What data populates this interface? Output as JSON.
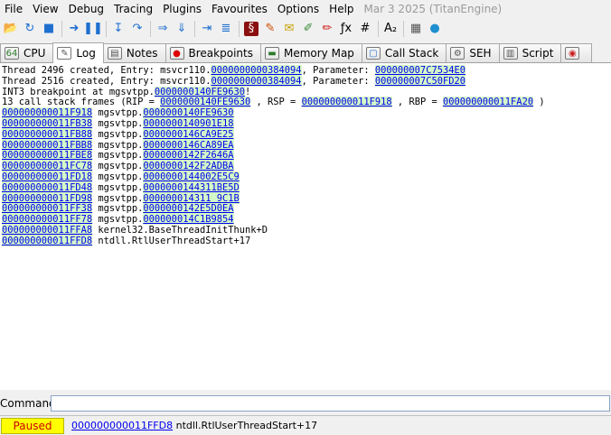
{
  "menu": {
    "items": [
      "File",
      "View",
      "Debug",
      "Tracing",
      "Plugins",
      "Favourites",
      "Options",
      "Help"
    ],
    "build_info": "Mar 3 2025 (TitanEngine)"
  },
  "toolbar": {
    "icons": [
      {
        "name": "open-icon",
        "glyph": "📂",
        "color": "#d8a000"
      },
      {
        "name": "restart-icon",
        "glyph": "↻",
        "color": "#1e6fd0"
      },
      {
        "name": "close-icon",
        "glyph": "■",
        "color": "#1e6fd0"
      },
      {
        "name": "sep1",
        "sep": true
      },
      {
        "name": "run-icon",
        "glyph": "➜",
        "color": "#1e6fd0"
      },
      {
        "name": "pause-icon",
        "glyph": "❚❚",
        "color": "#1e6fd0"
      },
      {
        "name": "sep2",
        "sep": true
      },
      {
        "name": "step-into-icon",
        "glyph": "↧",
        "color": "#1e6fd0"
      },
      {
        "name": "step-over-icon",
        "glyph": "↷",
        "color": "#1e6fd0"
      },
      {
        "name": "sep3",
        "sep": true
      },
      {
        "name": "trace-into-icon",
        "glyph": "⇒",
        "color": "#1e6fd0"
      },
      {
        "name": "trace-over-icon",
        "glyph": "⇓",
        "color": "#1e6fd0"
      },
      {
        "name": "sep4",
        "sep": true
      },
      {
        "name": "run-to-user-code-icon",
        "glyph": "⇥",
        "color": "#1e6fd0"
      },
      {
        "name": "animate-icon",
        "glyph": "≣",
        "color": "#1e6fd0"
      },
      {
        "name": "sep5",
        "sep": true
      },
      {
        "name": "scylla-icon",
        "glyph": "§",
        "color": "#ffffff",
        "bg": "#8b1010"
      },
      {
        "name": "patch-icon",
        "glyph": "✎",
        "color": "#d04a00"
      },
      {
        "name": "comments-icon",
        "glyph": "✉",
        "color": "#c8a000"
      },
      {
        "name": "labels-icon",
        "glyph": "✐",
        "color": "#3a8a3a"
      },
      {
        "name": "bookmarks-icon",
        "glyph": "✏",
        "color": "#d02020"
      },
      {
        "name": "functions-icon",
        "glyph": "ƒx",
        "color": "#000000"
      },
      {
        "name": "hash-icon",
        "glyph": "#",
        "color": "#000000"
      },
      {
        "name": "sep6",
        "sep": true
      },
      {
        "name": "strings-icon",
        "glyph": "A₂",
        "color": "#000000"
      },
      {
        "name": "sep7",
        "sep": true
      },
      {
        "name": "calculator-icon",
        "glyph": "▦",
        "color": "#555555"
      },
      {
        "name": "globe-icon",
        "glyph": "●",
        "color": "#1e8fd0"
      }
    ]
  },
  "tabs": [
    {
      "name": "tab-cpu",
      "label": "CPU",
      "icon": "cpu-icon",
      "glyph": "64",
      "color": "#2a7a2a",
      "active": false
    },
    {
      "name": "tab-log",
      "label": "Log",
      "icon": "log-icon",
      "glyph": "✎",
      "color": "#555",
      "active": true
    },
    {
      "name": "tab-notes",
      "label": "Notes",
      "icon": "notes-icon",
      "glyph": "▤",
      "color": "#555",
      "active": false
    },
    {
      "name": "tab-breakpoints",
      "label": "Breakpoints",
      "icon": "breakpoint-icon",
      "glyph": "●",
      "color": "#dd0000",
      "active": false
    },
    {
      "name": "tab-memory-map",
      "label": "Memory Map",
      "icon": "memory-map-icon",
      "glyph": "▬",
      "color": "#2a7a2a",
      "active": false
    },
    {
      "name": "tab-call-stack",
      "label": "Call Stack",
      "icon": "call-stack-icon",
      "glyph": "▢",
      "color": "#1e6fd0",
      "active": false
    },
    {
      "name": "tab-seh",
      "label": "SEH",
      "icon": "seh-icon",
      "glyph": "⚙",
      "color": "#555",
      "active": false
    },
    {
      "name": "tab-script",
      "label": "Script",
      "icon": "script-icon",
      "glyph": "▥",
      "color": "#555",
      "active": false
    },
    {
      "name": "tab-symbols",
      "label": "",
      "icon": "symbols-icon",
      "glyph": "◉",
      "color": "#cc2020",
      "active": false
    }
  ],
  "log": {
    "lines": [
      [
        {
          "t": "Thread 2496 created, Entry: msvcr110."
        },
        {
          "t": "0000000000384094",
          "link": true
        },
        {
          "t": ", Parameter: "
        },
        {
          "t": "000000007C7534E0",
          "link": true
        }
      ],
      [
        {
          "t": "Thread 2516 created, Entry: msvcr110."
        },
        {
          "t": "0000000000384094",
          "link": true
        },
        {
          "t": ", Parameter: "
        },
        {
          "t": "000000007C50FD20",
          "link": true
        }
      ],
      [
        {
          "t": "INT3 breakpoint at mgsvtpp."
        },
        {
          "t": "0000000140FE9630",
          "link": true
        },
        {
          "t": "!"
        }
      ],
      [
        {
          "t": "13 call stack frames (RIP = "
        },
        {
          "t": "0000000140FE9630",
          "link": true
        },
        {
          "t": " , RSP = "
        },
        {
          "t": "000000000011F918",
          "link": true
        },
        {
          "t": " , RBP = "
        },
        {
          "t": "000000000011FA20",
          "link": true
        },
        {
          "t": " )"
        }
      ],
      [
        {
          "t": "000000000011F918",
          "link": true
        },
        {
          "t": " mgsvtpp."
        },
        {
          "t": "0000000140FE9630",
          "link": true
        }
      ],
      [
        {
          "t": "000000000011FB38",
          "link": true
        },
        {
          "t": " mgsvtpp."
        },
        {
          "t": "0000000140901E18",
          "link": true
        }
      ],
      [
        {
          "t": "000000000011FB88",
          "link": true
        },
        {
          "t": " mgsvtpp."
        },
        {
          "t": "0000000146CA9E25",
          "link": true
        }
      ],
      [
        {
          "t": "000000000011FBB8",
          "link": true
        },
        {
          "t": " mgsvtpp."
        },
        {
          "t": "0000000146CA89EA",
          "link": true
        }
      ],
      [
        {
          "t": "000000000011FBE8",
          "link": true
        },
        {
          "t": " mgsvtpp."
        },
        {
          "t": "0000000142F2646A",
          "link": true
        }
      ],
      [
        {
          "t": "000000000011FC78",
          "link": true
        },
        {
          "t": " mgsvtpp."
        },
        {
          "t": "0000000142F2ADBA",
          "link": true
        }
      ],
      [
        {
          "t": "000000000011FD18",
          "link": true
        },
        {
          "t": " mgsvtpp."
        },
        {
          "t": "0000000144002E5C9",
          "link": true
        }
      ],
      [
        {
          "t": "000000000011FD48",
          "link": true
        },
        {
          "t": " mgsvtpp."
        },
        {
          "t": "0000000144311BE5D",
          "link": true
        }
      ],
      [
        {
          "t": "000000000011FD98",
          "link": true
        },
        {
          "t": " mgsvtpp."
        },
        {
          "t": "000000014311 9C1B",
          "link": true
        }
      ],
      [
        {
          "t": "000000000011FF38",
          "link": true
        },
        {
          "t": " mgsvtpp."
        },
        {
          "t": "0000000142E5D0EA",
          "link": true
        }
      ],
      [
        {
          "t": "000000000011FF78",
          "link": true
        },
        {
          "t": " mgsvtpp."
        },
        {
          "t": "000000014C1B9854",
          "link": true
        }
      ],
      [
        {
          "t": "000000000011FFA8",
          "link": true
        },
        {
          "t": " kernel32.BaseThreadInitThunk+D"
        }
      ],
      [
        {
          "t": "000000000011FFD8",
          "link": true
        },
        {
          "t": " ntdll.RtlUserThreadStart+17"
        }
      ]
    ]
  },
  "command": {
    "label": "Command:",
    "value": ""
  },
  "status": {
    "state": "Paused",
    "address": "000000000011FFD8",
    "symbol": " ntdll.RtlUserThreadStart+17"
  }
}
